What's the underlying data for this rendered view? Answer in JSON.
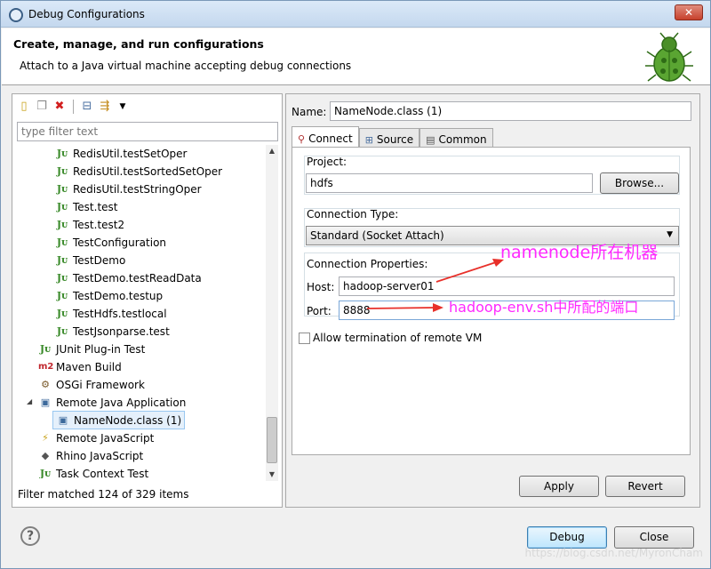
{
  "window": {
    "title": "Debug Configurations",
    "close_glyph": "✕"
  },
  "header": {
    "title": "Create, manage, and run configurations",
    "description": "Attach to a Java virtual machine accepting debug connections"
  },
  "left": {
    "toolbar": [
      "new-config-icon",
      "duplicate-icon",
      "delete-icon",
      "collapse-all-icon",
      "filter-icon",
      "dropdown-icon"
    ],
    "filter_placeholder": "type filter text",
    "tree": [
      {
        "label": "RedisUtil.testSetOper",
        "icon": "JU"
      },
      {
        "label": "RedisUtil.testSortedSetOper",
        "icon": "JU"
      },
      {
        "label": "RedisUtil.testStringOper",
        "icon": "JU"
      },
      {
        "label": "Test.test",
        "icon": "JU"
      },
      {
        "label": "Test.test2",
        "icon": "JU"
      },
      {
        "label": "TestConfiguration",
        "icon": "JU"
      },
      {
        "label": "TestDemo",
        "icon": "JU"
      },
      {
        "label": "TestDemo.testReadData",
        "icon": "JU"
      },
      {
        "label": "TestDemo.testup",
        "icon": "JU"
      },
      {
        "label": "TestHdfs.testlocal",
        "icon": "JU"
      },
      {
        "label": "TestJsonparse.test",
        "icon": "JU"
      },
      {
        "label": "JUnit Plug-in Test",
        "icon": "JU"
      },
      {
        "label": "Maven Build",
        "icon": "m2"
      },
      {
        "label": "OSGi Framework",
        "icon": "⚙"
      },
      {
        "label": "Remote Java Application",
        "icon": "▣"
      },
      {
        "label": "NameNode.class (1)",
        "icon": "▣"
      },
      {
        "label": "Remote JavaScript",
        "icon": "⚡"
      },
      {
        "label": "Rhino JavaScript",
        "icon": "🦏"
      },
      {
        "label": "Task Context Test",
        "icon": "JU"
      }
    ],
    "status": "Filter matched 124 of 329 items"
  },
  "right": {
    "name_label": "Name:",
    "name_value": "NameNode.class (1)",
    "tabs": [
      {
        "label": "Connect",
        "icon": "⚲"
      },
      {
        "label": "Source",
        "icon": "⊞"
      },
      {
        "label": "Common",
        "icon": "▤"
      }
    ],
    "project_label": "Project:",
    "project_value": "hdfs",
    "browse_label": "Browse...",
    "connection_type_label": "Connection Type:",
    "connection_type_value": "Standard (Socket Attach)",
    "connection_props_label": "Connection Properties:",
    "host_label": "Host:",
    "host_value": "hadoop-server01",
    "port_label": "Port:",
    "port_value": "8888",
    "allow_termination_label": "Allow termination of remote VM",
    "apply_label": "Apply",
    "revert_label": "Revert"
  },
  "annotations": {
    "host_note": "namenode所在机器",
    "port_note": "hadoop-env.sh中所配的端口",
    "color": "#ff28ff"
  },
  "footer": {
    "help_glyph": "?",
    "debug_label": "Debug",
    "close_label": "Close",
    "watermark": "https://blog.csdn.net/MyronCham"
  }
}
